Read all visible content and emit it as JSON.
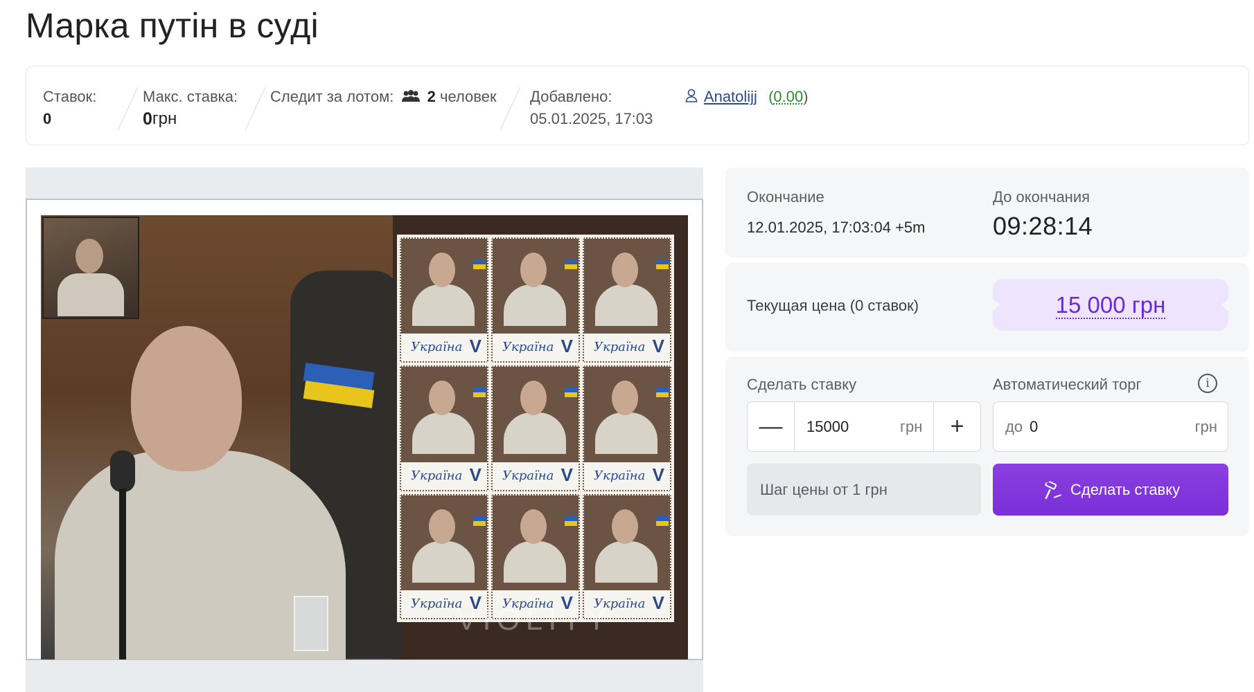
{
  "title": "Марка путін в суді",
  "stats": {
    "bids_label": "Ставок:",
    "bids_value": "0",
    "max_bid_label": "Макс. ставка:",
    "max_bid_amount": "0",
    "max_bid_currency": "грн",
    "watchers_label": "Следит за лотом:",
    "watchers_count": "2",
    "watchers_unit": "человек",
    "added_label": "Добавлено:",
    "added_value": "05.01.2025, 17:03",
    "seller_name": "Anatolijj",
    "seller_rating": "0.00"
  },
  "auction": {
    "end_label": "Окончание",
    "end_value": "12.01.2025, 17:03:04 +5m",
    "remaining_label": "До окончания",
    "remaining_value": "09:28:14",
    "current_price_label": "Текущая цена (0 ставок)",
    "current_price_value": "15 000 грн",
    "bid_label": "Сделать ставку",
    "bid_value": "15000",
    "bid_unit": "грн",
    "auto_label": "Автоматический торг",
    "auto_prefix": "до",
    "auto_value": "0",
    "auto_unit": "грн",
    "step_note": "Шаг цены от 1 грн",
    "bid_button": "Сделать ставку"
  },
  "image": {
    "stamp_text": "Україна",
    "stamp_letter": "V",
    "watermark": "VIOLITY"
  },
  "icons": {
    "watchers": "people-icon",
    "seller": "user-icon",
    "minus": "minus-icon",
    "plus": "plus-icon",
    "info": "info-icon",
    "gavel": "gavel-icon"
  },
  "colors": {
    "accent": "#7b2fd8",
    "price_bg": "#efe4fd",
    "price_text": "#6a2bd6",
    "rating": "#2f8a2f"
  }
}
